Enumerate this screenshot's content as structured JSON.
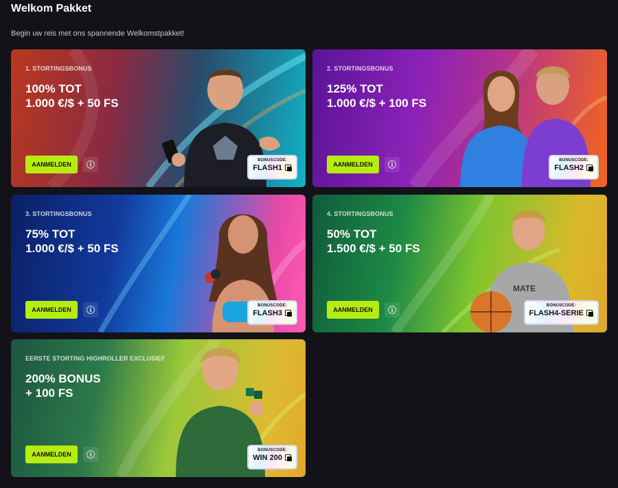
{
  "page": {
    "title": "Welkom Pakket",
    "subtitle": "Begin uw reis met ons spannende Welkomstpakket!"
  },
  "cards": [
    {
      "label": "1. STORTINGSBONUS",
      "headline_1": "100% TOT",
      "headline_2": "1.000 €/$ + 50 FS",
      "cta": "AANMELDEN",
      "code_label": "BONUSCODE:",
      "code": "FLASH1",
      "theme": [
        "#d4502a",
        "#7a2458",
        "#12b4c9"
      ]
    },
    {
      "label": "2. STORTINGSBONUS",
      "headline_1": "125% TOT",
      "headline_2": "1.000 €/$ + 100 FS",
      "cta": "AANMELDEN",
      "code_label": "BONUSCODE:",
      "code": "FLASH2",
      "theme": [
        "#7b1fb6",
        "#b62c96",
        "#f26a1e"
      ]
    },
    {
      "label": "3. STORTINGSBONUS",
      "headline_1": "75% TOT",
      "headline_2": "1.000 €/$ + 50 FS",
      "cta": "AANMELDEN",
      "code_label": "BONUSCODE:",
      "code": "FLASH3",
      "theme": [
        "#0d2e7e",
        "#1a6bd6",
        "#f04fa8"
      ]
    },
    {
      "label": "4. STORTINGSBONUS",
      "headline_1": "50% TOT",
      "headline_2": "1.500 €/$ + 50 FS",
      "cta": "AANMELDEN",
      "code_label": "BONUSCODE:",
      "code": "FLASH4-SERIE",
      "theme": [
        "#147a46",
        "#7ccf2e",
        "#e6b12a"
      ]
    },
    {
      "label": "EERSTE STORTING HIGHROLLER EXCLUSIEF",
      "headline_1": "200% BONUS",
      "headline_2": "+ 100 FS",
      "cta": "AANMELDEN",
      "code_label": "BONUSCODE:",
      "code": "WIN 200",
      "theme": [
        "#1f5e46",
        "#a5cd2c",
        "#e0b32e"
      ]
    }
  ],
  "icons": {
    "info": "info-icon",
    "copy": "copy-icon"
  },
  "colors": {
    "background": "#121218",
    "cta": "#b6ec12"
  }
}
